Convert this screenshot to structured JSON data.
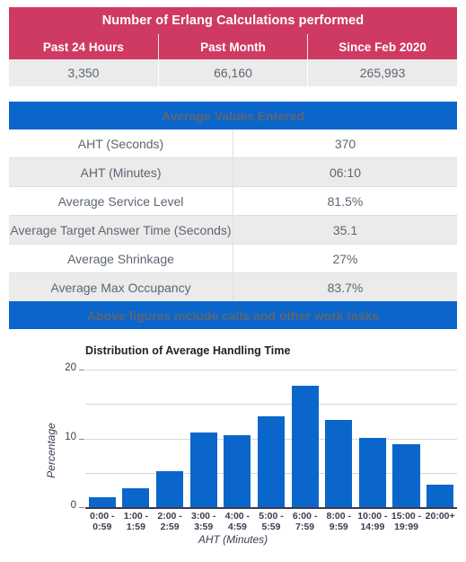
{
  "erlang_table": {
    "title": "Number of Erlang Calculations performed",
    "columns": [
      "Past 24 Hours",
      "Past Month",
      "Since Feb 2020"
    ],
    "values": [
      "3,350",
      "66,160",
      "265,993"
    ]
  },
  "average_table": {
    "title": "Average Values Entered",
    "footer": "Above figures include calls and other work tasks",
    "rows": [
      {
        "label": "AHT (Seconds)",
        "value": "370"
      },
      {
        "label": "AHT (Minutes)",
        "value": "06:10"
      },
      {
        "label": "Average Service Level",
        "value": "81.5%"
      },
      {
        "label": "Average Target Answer Time (Seconds)",
        "value": "35.1"
      },
      {
        "label": "Average Shrinkage",
        "value": "27%"
      },
      {
        "label": "Average Max Occupancy",
        "value": "83.7%"
      }
    ]
  },
  "chart_data": {
    "type": "bar",
    "title": "Distribution of Average Handling Time",
    "xlabel": "AHT (Minutes)",
    "ylabel": "Percentage",
    "categories": [
      "0:00 - 0:59",
      "1:00 - 1:59",
      "2:00 - 2:59",
      "3:00 - 3:59",
      "4:00 - 4:59",
      "5:00 - 5:59",
      "6:00 - 7:59",
      "8:00 - 9:59",
      "10:00 - 14:99",
      "15:00 - 19:99",
      "20:00+"
    ],
    "category_lines": [
      [
        "0:00 -",
        "0:59"
      ],
      [
        "1:00 -",
        "1:59"
      ],
      [
        "2:00 -",
        "2:59"
      ],
      [
        "3:00 -",
        "3:59"
      ],
      [
        "4:00 -",
        "4:59"
      ],
      [
        "5:00 -",
        "5:59"
      ],
      [
        "6:00 -",
        "7:59"
      ],
      [
        "8:00 -",
        "9:59"
      ],
      [
        "10:00 -",
        "14:99"
      ],
      [
        "15:00 -",
        "19:99"
      ],
      [
        "20:00+",
        ""
      ]
    ],
    "values": [
      1.5,
      2.8,
      5.2,
      10.8,
      10.5,
      13.2,
      17.6,
      12.7,
      10.1,
      9.1,
      3.3
    ],
    "ylim": [
      0,
      20
    ],
    "yticks": [
      0,
      10,
      20
    ],
    "gridlines": [
      0,
      5,
      10,
      15,
      20
    ],
    "grid": true,
    "legend": "none",
    "bar_color": "#0a66cb"
  },
  "colors": {
    "pink": "#cf3a62",
    "blue": "#0a66cb",
    "row_alt": "#ebebeb",
    "text": "#5d6672"
  }
}
